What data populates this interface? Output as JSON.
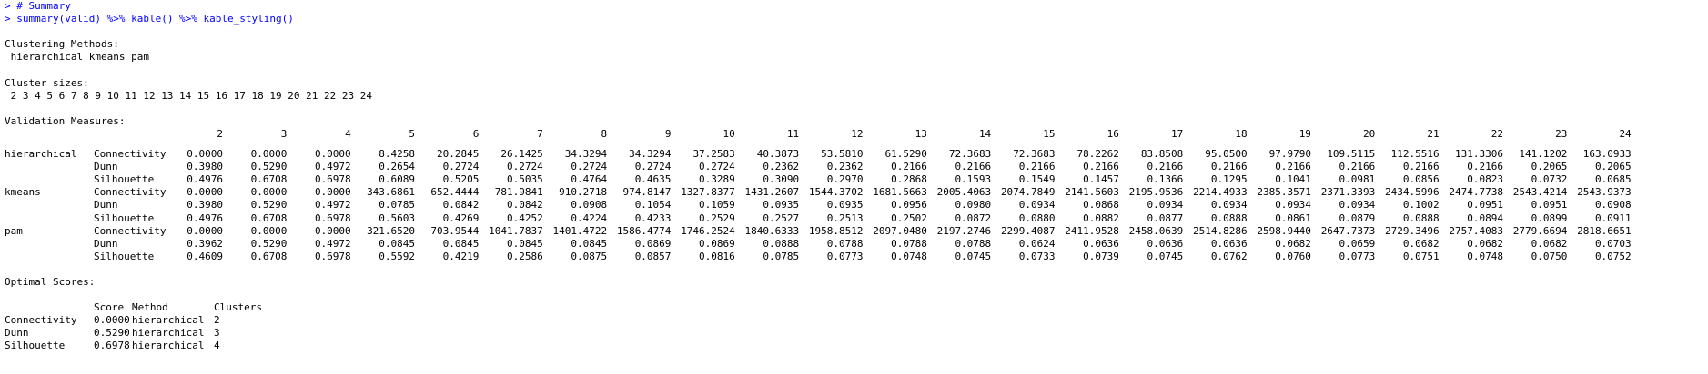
{
  "console": {
    "prompt": ">",
    "command_lines": [
      "# Summary",
      "summary(valid) %>% kable() %>% kable_styling()"
    ],
    "clustering_methods_heading": "Clustering Methods:",
    "clustering_methods_value": "hierarchical kmeans pam",
    "cluster_sizes_heading": "Cluster sizes:",
    "cluster_sizes_value": "2 3 4 5 6 7 8 9 10 11 12 13 14 15 16 17 18 19 20 21 22 23 24",
    "validation_heading": "Validation Measures:",
    "optimal_heading": "Optimal Scores:"
  },
  "validation": {
    "columns": [
      "2",
      "3",
      "4",
      "5",
      "6",
      "7",
      "8",
      "9",
      "10",
      "11",
      "12",
      "13",
      "14",
      "15",
      "16",
      "17",
      "18",
      "19",
      "20",
      "21",
      "22",
      "23",
      "24"
    ],
    "rows": [
      {
        "group": "hierarchical",
        "measure": "Connectivity",
        "values": [
          "0.0000",
          "0.0000",
          "0.0000",
          "8.4258",
          "20.2845",
          "26.1425",
          "34.3294",
          "34.3294",
          "37.2583",
          "40.3873",
          "53.5810",
          "61.5290",
          "72.3683",
          "72.3683",
          "78.2262",
          "83.8508",
          "95.0500",
          "97.9790",
          "109.5115",
          "112.5516",
          "131.3306",
          "141.1202",
          "163.0933"
        ]
      },
      {
        "group": "",
        "measure": "Dunn",
        "values": [
          "0.3980",
          "0.5290",
          "0.4972",
          "0.2654",
          "0.2724",
          "0.2724",
          "0.2724",
          "0.2724",
          "0.2724",
          "0.2362",
          "0.2362",
          "0.2166",
          "0.2166",
          "0.2166",
          "0.2166",
          "0.2166",
          "0.2166",
          "0.2166",
          "0.2166",
          "0.2166",
          "0.2166",
          "0.2065",
          "0.2065"
        ]
      },
      {
        "group": "",
        "measure": "Silhouette",
        "values": [
          "0.4976",
          "0.6708",
          "0.6978",
          "0.6089",
          "0.5205",
          "0.5035",
          "0.4764",
          "0.4635",
          "0.3289",
          "0.3090",
          "0.2970",
          "0.2868",
          "0.1593",
          "0.1549",
          "0.1457",
          "0.1366",
          "0.1295",
          "0.1041",
          "0.0981",
          "0.0856",
          "0.0823",
          "0.0732",
          "0.0685"
        ]
      },
      {
        "group": "kmeans",
        "measure": "Connectivity",
        "values": [
          "0.0000",
          "0.0000",
          "0.0000",
          "343.6861",
          "652.4444",
          "781.9841",
          "910.2718",
          "974.8147",
          "1327.8377",
          "1431.2607",
          "1544.3702",
          "1681.5663",
          "2005.4063",
          "2074.7849",
          "2141.5603",
          "2195.9536",
          "2214.4933",
          "2385.3571",
          "2371.3393",
          "2434.5996",
          "2474.7738",
          "2543.4214",
          "2543.9373"
        ]
      },
      {
        "group": "",
        "measure": "Dunn",
        "values": [
          "0.3980",
          "0.5290",
          "0.4972",
          "0.0785",
          "0.0842",
          "0.0842",
          "0.0908",
          "0.1054",
          "0.1059",
          "0.0935",
          "0.0935",
          "0.0956",
          "0.0980",
          "0.0934",
          "0.0868",
          "0.0934",
          "0.0934",
          "0.0934",
          "0.0934",
          "0.1002",
          "0.0951",
          "0.0951",
          "0.0908"
        ]
      },
      {
        "group": "",
        "measure": "Silhouette",
        "values": [
          "0.4976",
          "0.6708",
          "0.6978",
          "0.5603",
          "0.4269",
          "0.4252",
          "0.4224",
          "0.4233",
          "0.2529",
          "0.2527",
          "0.2513",
          "0.2502",
          "0.0872",
          "0.0880",
          "0.0882",
          "0.0877",
          "0.0888",
          "0.0861",
          "0.0879",
          "0.0888",
          "0.0894",
          "0.0899",
          "0.0911"
        ]
      },
      {
        "group": "pam",
        "measure": "Connectivity",
        "values": [
          "0.0000",
          "0.0000",
          "0.0000",
          "321.6520",
          "703.9544",
          "1041.7837",
          "1401.4722",
          "1586.4774",
          "1746.2524",
          "1840.6333",
          "1958.8512",
          "2097.0480",
          "2197.2746",
          "2299.4087",
          "2411.9528",
          "2458.0639",
          "2514.8286",
          "2598.9440",
          "2647.7373",
          "2729.3496",
          "2757.4083",
          "2779.6694",
          "2818.6651"
        ]
      },
      {
        "group": "",
        "measure": "Dunn",
        "values": [
          "0.3962",
          "0.5290",
          "0.4972",
          "0.0845",
          "0.0845",
          "0.0845",
          "0.0845",
          "0.0869",
          "0.0869",
          "0.0888",
          "0.0788",
          "0.0788",
          "0.0788",
          "0.0624",
          "0.0636",
          "0.0636",
          "0.0636",
          "0.0682",
          "0.0659",
          "0.0682",
          "0.0682",
          "0.0682",
          "0.0703"
        ]
      },
      {
        "group": "",
        "measure": "Silhouette",
        "values": [
          "0.4609",
          "0.6708",
          "0.6978",
          "0.5592",
          "0.4219",
          "0.2586",
          "0.0875",
          "0.0857",
          "0.0816",
          "0.0785",
          "0.0773",
          "0.0748",
          "0.0745",
          "0.0733",
          "0.0739",
          "0.0745",
          "0.0762",
          "0.0760",
          "0.0773",
          "0.0751",
          "0.0748",
          "0.0750",
          "0.0752"
        ]
      }
    ]
  },
  "optimal": {
    "headers": {
      "score": "Score",
      "method": "Method",
      "clusters": "Clusters"
    },
    "rows": [
      {
        "measure": "Connectivity",
        "score": "0.0000",
        "method": "hierarchical",
        "clusters": "2"
      },
      {
        "measure": "Dunn",
        "score": "0.5290",
        "method": "hierarchical",
        "clusters": "3"
      },
      {
        "measure": "Silhouette",
        "score": "0.6978",
        "method": "hierarchical",
        "clusters": "4"
      }
    ]
  },
  "colors": {
    "command": "#0000ff",
    "output": "#000000",
    "background": "#ffffff"
  }
}
